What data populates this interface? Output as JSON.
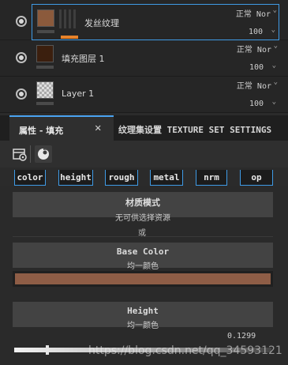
{
  "layers": [
    {
      "name": "发丝纹理",
      "blend": "正常 Nor",
      "opacity": "100",
      "selected": true,
      "thumb_color": "#8b5a3c"
    },
    {
      "name": "填充图层 1",
      "blend": "正常 Nor",
      "opacity": "100",
      "selected": false,
      "thumb_color": "#3b1f0e"
    },
    {
      "name": "Layer 1",
      "blend": "正常 Nor",
      "opacity": "100",
      "selected": false,
      "thumb_color": "checker"
    }
  ],
  "tabs": {
    "active_label": "属性 - 填充",
    "close_symbol": "✕",
    "inactive_label": "纹理集设置 TEXTURE SET SETTINGS"
  },
  "toolbar": {
    "icons": [
      "fill-settings-icon",
      "material-sphere-icon"
    ]
  },
  "channels": [
    "color",
    "height",
    "rough",
    "metal",
    "nrm",
    "op"
  ],
  "properties": {
    "material_mode_title": "材质模式",
    "material_mode_sub": "无可供选择资源",
    "or_text": "或",
    "base_color_title": "Base Color",
    "base_color_sub": "均一颜色",
    "base_color_value": "#8e5d46",
    "height_title": "Height",
    "height_sub": "均一颜色",
    "height_value": "0.1299",
    "height_fraction": 0.1299
  },
  "watermark": "https://blog.csdn.net/qq_34593121"
}
